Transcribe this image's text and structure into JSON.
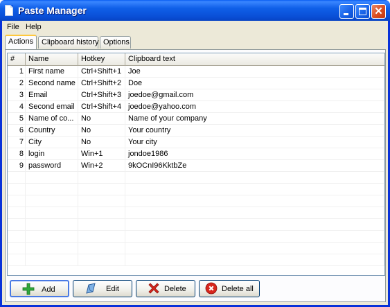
{
  "window": {
    "title": "Paste Manager"
  },
  "menu": {
    "file": "File",
    "help": "Help"
  },
  "tabs": [
    {
      "label": "Actions"
    },
    {
      "label": "Clipboard history"
    },
    {
      "label": "Options"
    }
  ],
  "grid": {
    "columns": [
      "#",
      "Name",
      "Hotkey",
      "Clipboard text"
    ],
    "rows": [
      {
        "num": "1",
        "name": "First name",
        "hotkey": "Ctrl+Shift+1",
        "text": "Joe"
      },
      {
        "num": "2",
        "name": "Second name",
        "hotkey": "Ctrl+Shift+2",
        "text": "Doe"
      },
      {
        "num": "3",
        "name": "Email",
        "hotkey": "Ctrl+Shift+3",
        "text": "joedoe@gmail.com"
      },
      {
        "num": "4",
        "name": "Second email",
        "hotkey": "Ctrl+Shift+4",
        "text": "joedoe@yahoo.com"
      },
      {
        "num": "5",
        "name": "Name of co...",
        "hotkey": "No",
        "text": "Name of your company"
      },
      {
        "num": "6",
        "name": "Country",
        "hotkey": "No",
        "text": "Your country"
      },
      {
        "num": "7",
        "name": "City",
        "hotkey": "No",
        "text": "Your city"
      },
      {
        "num": "8",
        "name": "login",
        "hotkey": "Win+1",
        "text": "jondoe1986"
      },
      {
        "num": "9",
        "name": "password",
        "hotkey": "Win+2",
        "text": "9kOCnI96KktbZe"
      }
    ],
    "empty_rows": 8
  },
  "buttons": {
    "add": "Add",
    "edit": "Edit",
    "delete": "Delete",
    "delete_all": "Delete all"
  },
  "colors": {
    "titlebar": "#0a56e6",
    "panel": "#ece9d8",
    "add_icon": "#2fa83a",
    "delete_icon": "#d8261c"
  }
}
